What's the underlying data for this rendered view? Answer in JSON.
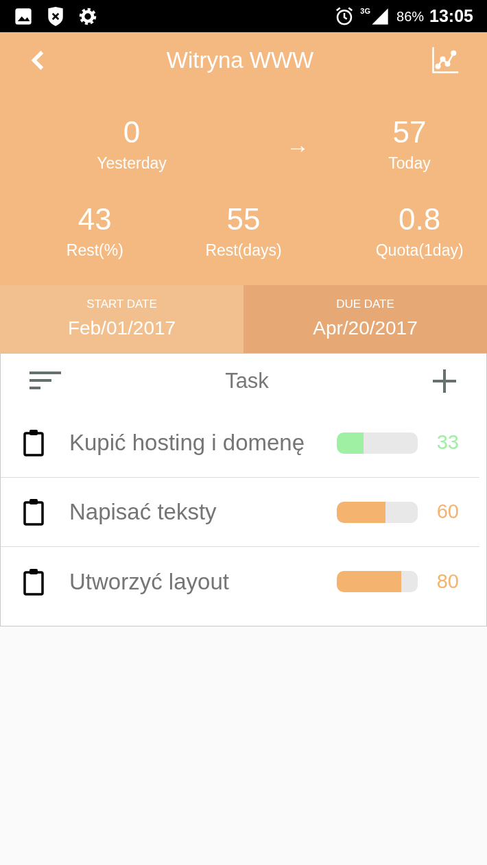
{
  "status_bar": {
    "network": "3G",
    "battery": "86%",
    "time": "13:05"
  },
  "header": {
    "title": "Witryna WWW"
  },
  "comparison": {
    "from": {
      "value": "0",
      "label": "Yesterday"
    },
    "arrow": "→",
    "to": {
      "value": "57",
      "label": "Today"
    }
  },
  "stats": [
    {
      "value": "43",
      "label": "Rest(%)"
    },
    {
      "value": "55",
      "label": "Rest(days)"
    },
    {
      "value": "0.8",
      "label": "Quota(1day)"
    }
  ],
  "dates": [
    {
      "label": "START DATE",
      "value": "Feb/01/2017"
    },
    {
      "label": "DUE DATE",
      "value": "Apr/20/2017"
    }
  ],
  "task_list": {
    "title": "Task",
    "tasks": [
      {
        "name": "Kupić hosting i domenę",
        "level": 0.33,
        "percent": "33",
        "color": "#9ff0a3"
      },
      {
        "name": "Napisać teksty",
        "level": 0.6,
        "percent": "60",
        "color": "#f4b470"
      },
      {
        "name": "Utworzyć layout",
        "level": 0.8,
        "percent": "80",
        "color": "#f4b470"
      }
    ]
  }
}
